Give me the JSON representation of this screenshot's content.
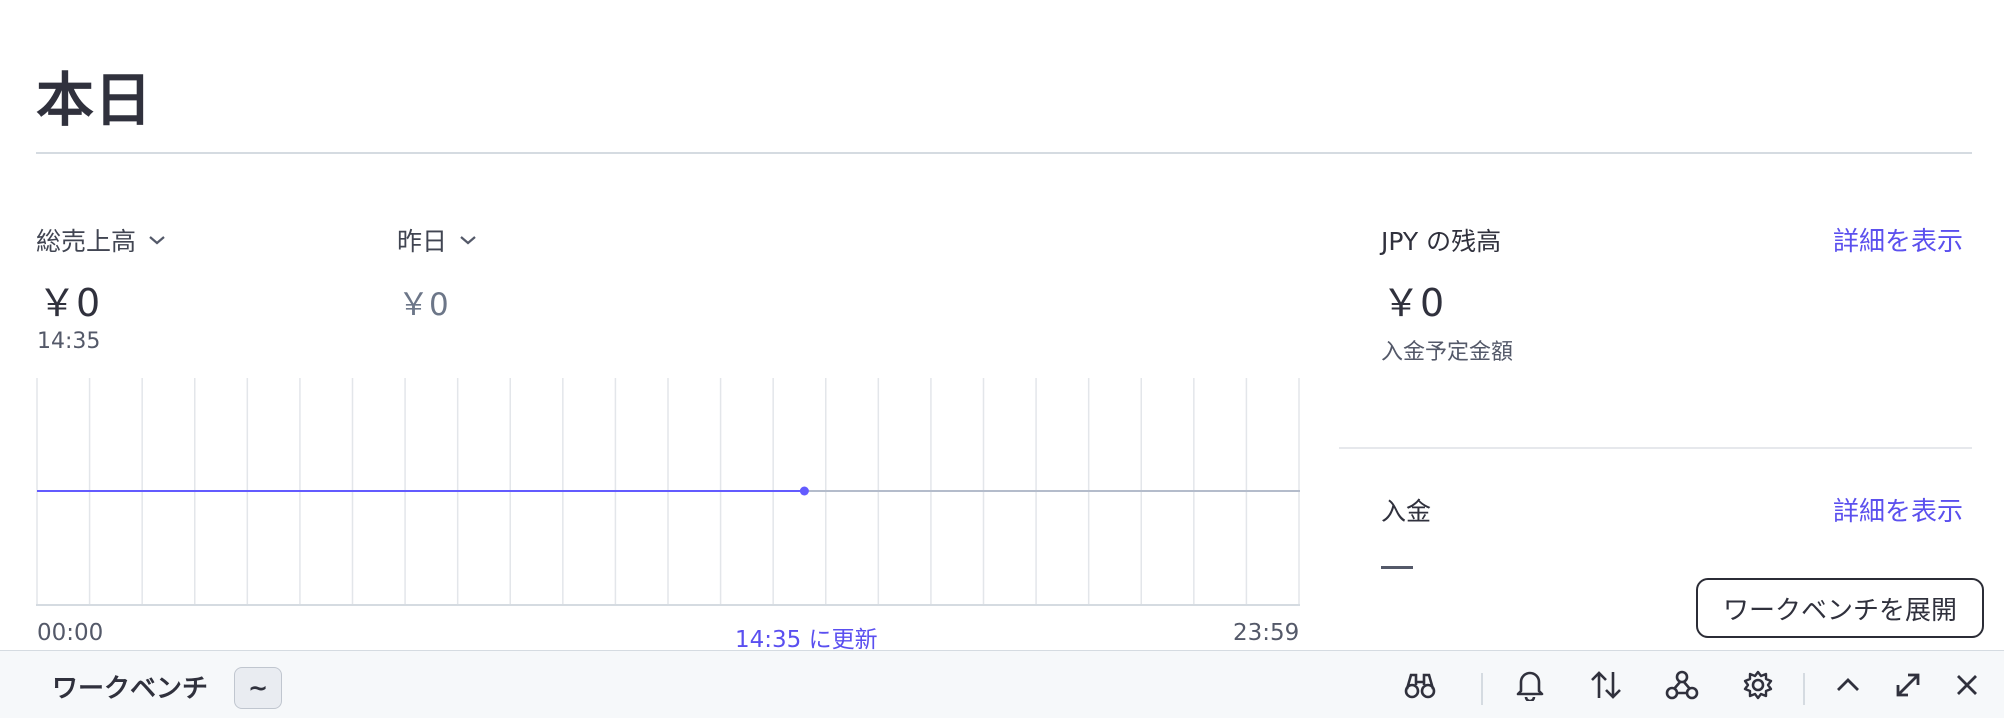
{
  "page": {
    "title": "本日"
  },
  "metrics": {
    "primary": {
      "label": "総売上高",
      "value": "￥0",
      "time": "14:35"
    },
    "compare": {
      "label": "昨日",
      "value": "￥0"
    }
  },
  "chart_data": {
    "type": "line",
    "x_start_label": "00:00",
    "x_end_label": "23:59",
    "updated_label": "14:35 に更新",
    "series": [
      {
        "values": [
          0,
          0
        ],
        "x": [
          "00:00",
          "14:35"
        ],
        "color": "#635bff"
      }
    ],
    "projection_color": "#b4bccb",
    "gridline_count": 25,
    "grid": true
  },
  "balance": {
    "title": "JPY の残高",
    "link": "詳細を表示",
    "amount": "￥0",
    "sub": "入金予定金額"
  },
  "payouts": {
    "title": "入金",
    "link": "詳細を表示",
    "value": "—"
  },
  "tooltip": {
    "text": "ワークベンチを展開"
  },
  "workbench": {
    "title": "ワークベンチ",
    "badge": "~",
    "icons": [
      "binoculars-icon",
      "bell-icon",
      "sort-arrows-icon",
      "webhook-icon",
      "gear-icon",
      "chevron-up-icon",
      "expand-icon",
      "close-icon"
    ]
  },
  "colors": {
    "accent": "#635bff",
    "text": "#30313d",
    "muted": "#6c7688"
  }
}
